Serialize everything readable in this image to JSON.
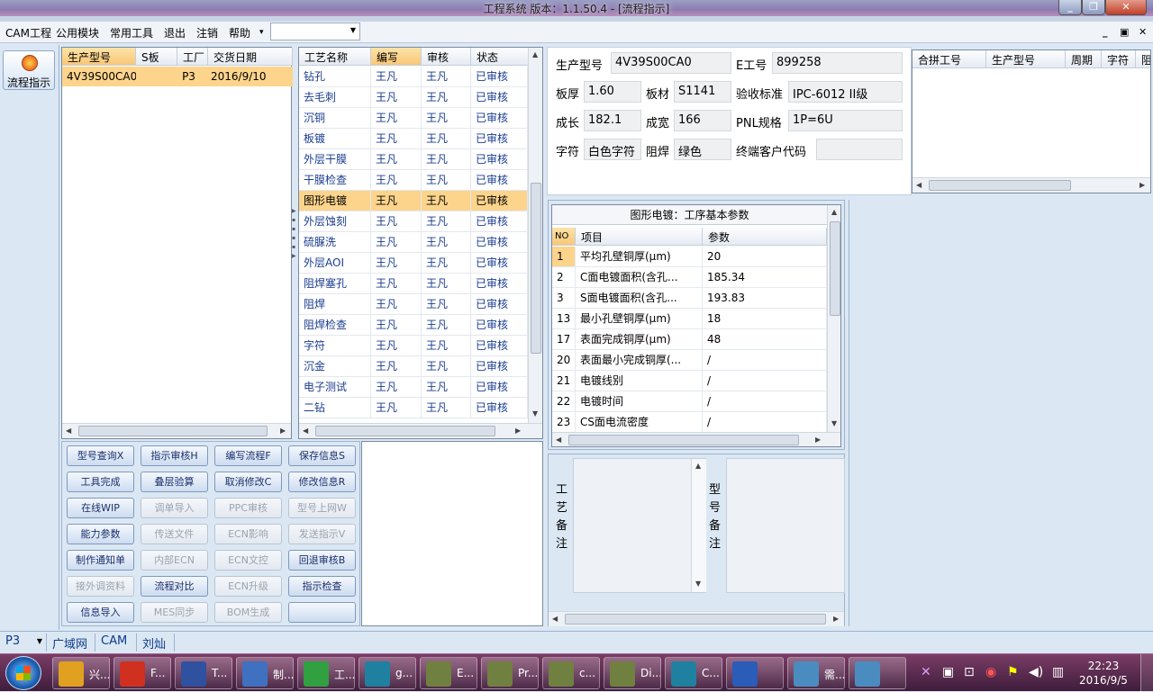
{
  "window": {
    "title": "工程系统   版本：1.1.50.4 - [流程指示]"
  },
  "menu": {
    "items": [
      "CAM工程",
      "公用模块",
      "常用工具",
      "退出",
      "注销",
      "帮助"
    ],
    "help_arrow": "▾",
    "combo_value": ""
  },
  "mdi": {
    "minimize": "_",
    "restore": "▣",
    "close": "✕"
  },
  "left_toolbar": {
    "label": "流程指示"
  },
  "model_grid": {
    "headers": [
      "生产型号",
      "S板",
      "工厂",
      "交货日期"
    ],
    "rows": [
      [
        "4V39S00CA0",
        "",
        "P3",
        "2016/9/10"
      ]
    ]
  },
  "process_grid": {
    "headers": [
      "工艺名称",
      "编写",
      "审核",
      "状态"
    ],
    "rows": [
      [
        "钻孔",
        "王凡",
        "王凡",
        "已审核"
      ],
      [
        "去毛刺",
        "王凡",
        "王凡",
        "已审核"
      ],
      [
        "沉铜",
        "王凡",
        "王凡",
        "已审核"
      ],
      [
        "板镀",
        "王凡",
        "王凡",
        "已审核"
      ],
      [
        "外层干膜",
        "王凡",
        "王凡",
        "已审核"
      ],
      [
        "干膜检查",
        "王凡",
        "王凡",
        "已审核"
      ],
      [
        "图形电镀",
        "王凡",
        "王凡",
        "已审核"
      ],
      [
        "外层蚀刻",
        "王凡",
        "王凡",
        "已审核"
      ],
      [
        "硫脲洗",
        "王凡",
        "王凡",
        "已审核"
      ],
      [
        "外层AOI",
        "王凡",
        "王凡",
        "已审核"
      ],
      [
        "阻焊塞孔",
        "王凡",
        "王凡",
        "已审核"
      ],
      [
        "阻焊",
        "王凡",
        "王凡",
        "已审核"
      ],
      [
        "阻焊检查",
        "王凡",
        "王凡",
        "已审核"
      ],
      [
        "字符",
        "王凡",
        "王凡",
        "已审核"
      ],
      [
        "沉金",
        "王凡",
        "王凡",
        "已审核"
      ],
      [
        "电子测试",
        "王凡",
        "王凡",
        "已审核"
      ],
      [
        "二钻",
        "王凡",
        "王凡",
        "已审核"
      ]
    ],
    "selected_index": 6
  },
  "buttons": [
    {
      "label": "型号查询X",
      "enabled": true
    },
    {
      "label": "指示审核H",
      "enabled": true
    },
    {
      "label": "编写流程F",
      "enabled": true
    },
    {
      "label": "保存信息S",
      "enabled": true
    },
    {
      "label": "工具完成",
      "enabled": true
    },
    {
      "label": "叠层验算",
      "enabled": true
    },
    {
      "label": "取消修改C",
      "enabled": true
    },
    {
      "label": "修改信息R",
      "enabled": true
    },
    {
      "label": "在线WIP",
      "enabled": true
    },
    {
      "label": "调单导入",
      "enabled": false
    },
    {
      "label": "PPC审核",
      "enabled": false
    },
    {
      "label": "型号上网W",
      "enabled": false
    },
    {
      "label": "能力参数",
      "enabled": true
    },
    {
      "label": "传送文件",
      "enabled": false
    },
    {
      "label": "ECN影响",
      "enabled": false
    },
    {
      "label": "发送指示V",
      "enabled": false
    },
    {
      "label": "制作通知单",
      "enabled": true
    },
    {
      "label": "内部ECN",
      "enabled": false
    },
    {
      "label": "ECN文控",
      "enabled": false
    },
    {
      "label": "回退审核B",
      "enabled": true
    },
    {
      "label": "接外调资料",
      "enabled": false
    },
    {
      "label": "流程对比",
      "enabled": true
    },
    {
      "label": "ECN升级",
      "enabled": false
    },
    {
      "label": "指示检查",
      "enabled": true
    },
    {
      "label": "信息导入",
      "enabled": true
    },
    {
      "label": "MES同步",
      "enabled": false
    },
    {
      "label": "BOM生成",
      "enabled": false
    },
    {
      "label": "",
      "enabled": true
    }
  ],
  "info": {
    "model_label": "生产型号",
    "model_value": "4V39S00CA0",
    "eno_label": "E工号",
    "eno_value": "899258",
    "thickness_label": "板厚",
    "thickness_value": "1.60",
    "material_label": "板材",
    "material_value": "S1141",
    "standard_label": "验收标准",
    "standard_value": "IPC-6012 II级",
    "length_label": "成长",
    "length_value": "182.1",
    "width_label": "成宽",
    "width_value": "166",
    "pnl_label": "PNL规格",
    "pnl_value": "1P=6U",
    "char_label": "字符",
    "char_value": "白色字符",
    "mask_label": "阻焊",
    "mask_value": "绿色",
    "customer_label": "终端客户代码",
    "customer_value": ""
  },
  "merge_grid": {
    "headers": [
      "合拼工号",
      "生产型号",
      "周期",
      "字符",
      "阻"
    ]
  },
  "params": {
    "title": "图形电镀：工序基本参数",
    "headers": [
      "NO",
      "项目",
      "参数"
    ],
    "rows": [
      [
        "1",
        "平均孔壁铜厚(μm)",
        "20"
      ],
      [
        "2",
        "C面电镀面积(含孔...",
        "185.34"
      ],
      [
        "3",
        "S面电镀面积(含孔...",
        "193.83"
      ],
      [
        "13",
        "最小孔壁铜厚(μm)",
        "18"
      ],
      [
        "17",
        "表面完成铜厚(μm)",
        "48"
      ],
      [
        "20",
        "表面最小完成铜厚(...",
        "/"
      ],
      [
        "21",
        "电镀线别",
        "/"
      ],
      [
        "22",
        "电镀时间",
        "/"
      ],
      [
        "23",
        "CS面电流密度",
        "/"
      ]
    ]
  },
  "notes": {
    "process_label": "工艺备注",
    "model_label": "型号备注"
  },
  "status": {
    "factory": "P3",
    "network": "广域网",
    "module": "CAM",
    "user": "刘灿"
  },
  "taskbar": {
    "items": [
      "兴...",
      "F...",
      "T...",
      "制...",
      "工...",
      "g...",
      "E...",
      "Pr...",
      "c...",
      "Di...",
      "C...",
      "",
      "需...",
      ""
    ],
    "time": "22:23",
    "date": "2016/9/5"
  }
}
